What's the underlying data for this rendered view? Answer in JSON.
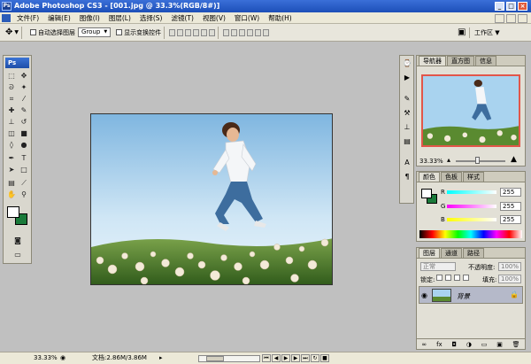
{
  "window": {
    "title": "Adobe Photoshop CS3 - [001.jpg @ 33.3%(RGB/8#)]",
    "minimize": "_",
    "restore": "□",
    "close": "×"
  },
  "menubar": {
    "items": [
      "文件(F)",
      "编辑(E)",
      "图像(I)",
      "图层(L)",
      "选择(S)",
      "滤镜(T)",
      "视图(V)",
      "窗口(W)",
      "帮助(H)"
    ]
  },
  "options": {
    "auto_select_label": "自动选择图层",
    "auto_select_value": "Group",
    "show_transform_label": "显示变换控件",
    "workspace_label": "工作区 ▼"
  },
  "toolbox": {
    "badge": "Ps"
  },
  "navigator": {
    "tabs": [
      "导航器",
      "直方图",
      "信息"
    ],
    "zoom": "33.33%"
  },
  "color": {
    "tabs": [
      "颜色",
      "色板",
      "样式"
    ],
    "channels": [
      {
        "label": "R",
        "value": "255"
      },
      {
        "label": "G",
        "value": "255"
      },
      {
        "label": "B",
        "value": "255"
      }
    ]
  },
  "layers": {
    "tabs": [
      "图层",
      "通道",
      "路径"
    ],
    "blend_mode": "正常",
    "opacity_label": "不透明度:",
    "opacity_value": "100%",
    "lock_label": "锁定:",
    "fill_label": "填充:",
    "fill_value": "100%",
    "layer_name": "背景"
  },
  "status": {
    "zoom": "33.33%",
    "doc": "文档:2.86M/3.86M"
  },
  "colors": {
    "titlebar": "#1d4fb8",
    "foreground": "#ffffff",
    "background": "#1a7a3a"
  }
}
